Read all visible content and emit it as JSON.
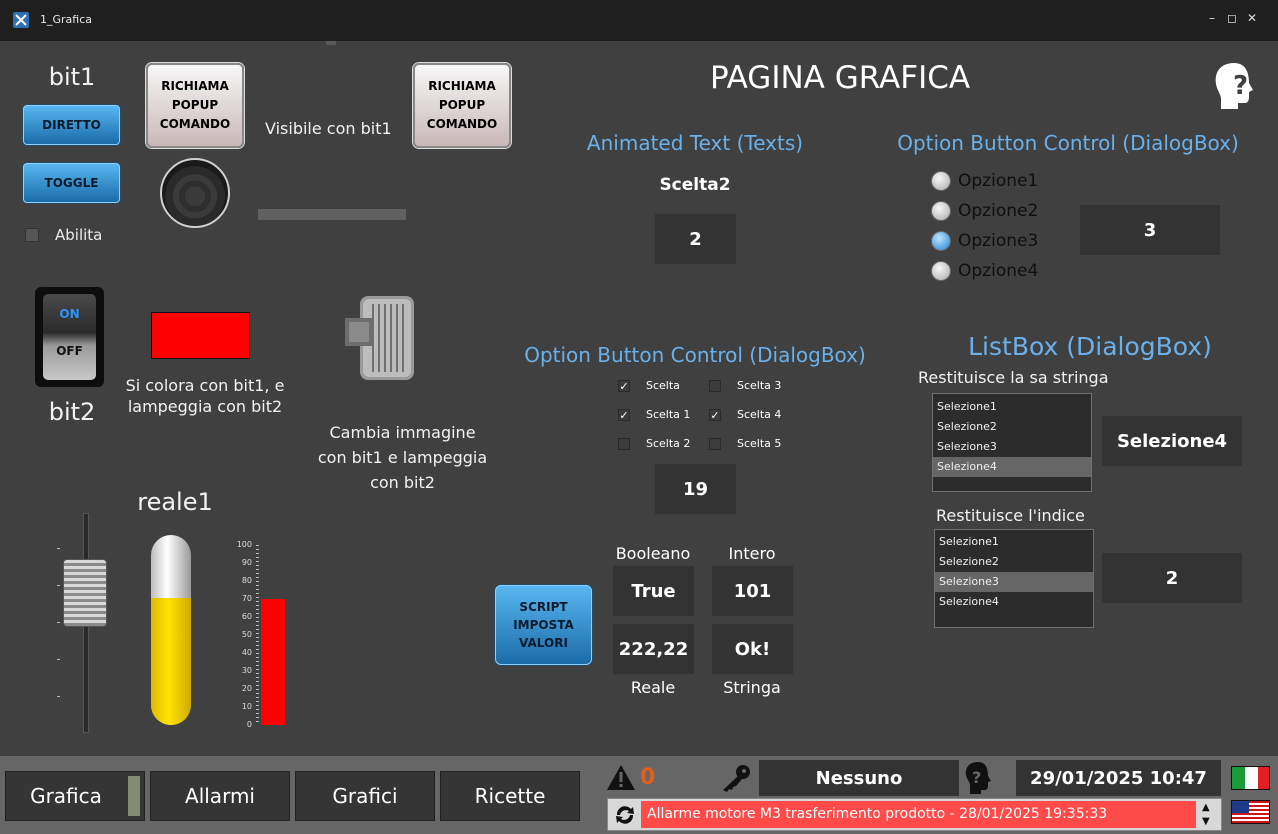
{
  "window": {
    "title": "1_Grafica",
    "controls": [
      "–",
      "◻",
      "✕"
    ]
  },
  "page_title": "PAGINA GRAFICA",
  "left": {
    "bit1_label": "bit1",
    "diretto": "DIRETTO",
    "toggle": "TOGGLE",
    "abilita": "Abilita",
    "popup_button": "RICHIAMA POPUP COMANDO",
    "visibile": "Visibile con bit1",
    "switch_on": "ON",
    "switch_off": "OFF",
    "bit2_label": "bit2",
    "rect_caption": "Si colora con bit1, e lampeggia con bit2",
    "motor_caption": "Cambia immagine con bit1 e lampeggia con bit2",
    "reale1_label": "reale1",
    "tank_level_pct": 67,
    "bar_level_pct": 70,
    "scale_ticks": [
      "100",
      "90",
      "80",
      "70",
      "60",
      "50",
      "40",
      "30",
      "20",
      "10",
      "0"
    ],
    "colors": {
      "rect": "#ff0000",
      "tank": "#ffd800",
      "bar": "#ff0000"
    }
  },
  "animated_text": {
    "title": "Animated Text (Texts)",
    "text": "Scelta2",
    "value": "2"
  },
  "option_radio": {
    "title": "Option Button Control (DialogBox)",
    "options": [
      "Opzione1",
      "Opzione2",
      "Opzione3",
      "Opzione4"
    ],
    "selected_index": 2,
    "value": "3"
  },
  "option_check": {
    "title": "Option Button Control (DialogBox)",
    "items": [
      {
        "label": "Scelta",
        "checked": true
      },
      {
        "label": "Scelta 1",
        "checked": true
      },
      {
        "label": "Scelta 2",
        "checked": false
      },
      {
        "label": "Scelta 3",
        "checked": false
      },
      {
        "label": "Scelta 4",
        "checked": true
      },
      {
        "label": "Scelta 5",
        "checked": false
      }
    ],
    "value": "19"
  },
  "listbox": {
    "title": "ListBox (DialogBox)",
    "string_label": "Restituisce la sa stringa",
    "list1": [
      "Selezione1",
      "Selezione2",
      "Selezione3",
      "Selezione4"
    ],
    "list1_selected": 3,
    "string_value": "Selezione4",
    "index_label": "Restituisce l'indice",
    "list2": [
      "Selezione1",
      "Selezione2",
      "Selezione3",
      "Selezione4"
    ],
    "list2_selected": 2,
    "index_value": "2"
  },
  "script": {
    "button": "SCRIPT IMPOSTA VALORI",
    "booleano_label": "Booleano",
    "booleano": "True",
    "intero_label": "Intero",
    "intero": "101",
    "reale": "222,22",
    "reale_label": "Reale",
    "stringa": "Ok!",
    "stringa_label": "Stringa"
  },
  "bottom": {
    "nav": [
      "Grafica",
      "Allarmi",
      "Grafici",
      "Ricette"
    ],
    "alarm_count": "0",
    "user": "Nessuno",
    "datetime": "29/01/2025 10:47",
    "alarm_message": "Allarme motore M3 trasferimento prodotto - 28/01/2025 19:35:33",
    "colors": {
      "alarm_bg": "#ff4a4a",
      "alarm_count": "#e0601a"
    }
  }
}
